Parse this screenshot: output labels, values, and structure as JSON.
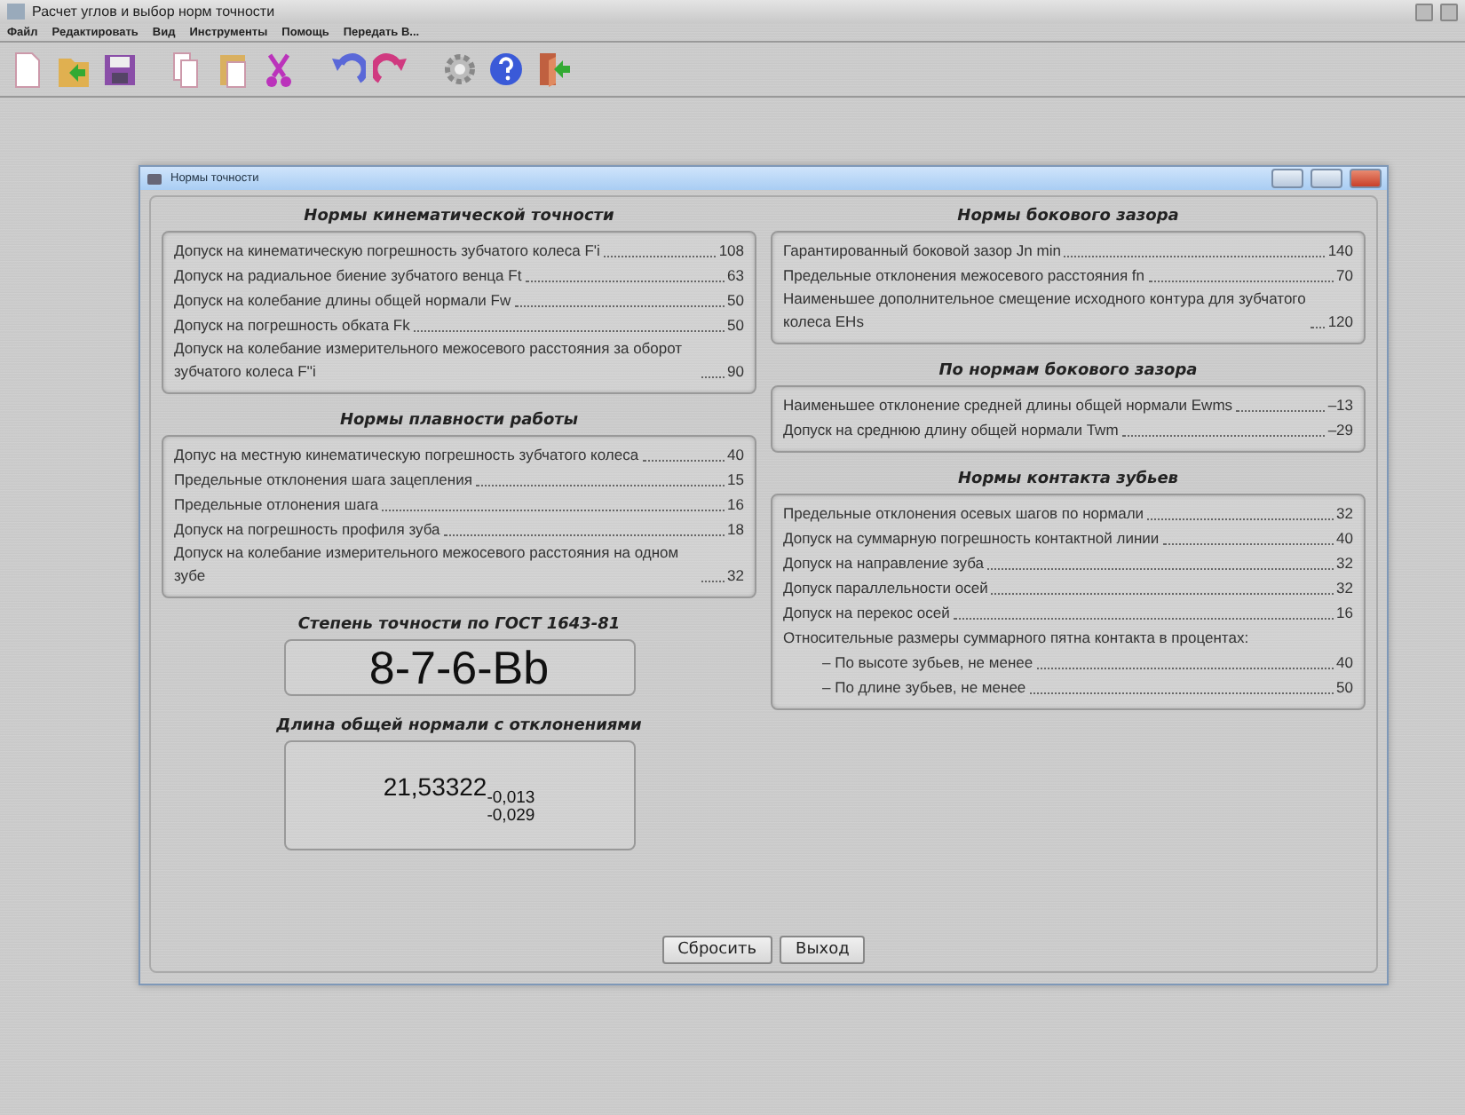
{
  "window": {
    "title": "Расчет углов и выбор норм точности"
  },
  "menu": [
    "Файл",
    "Редактировать",
    "Вид",
    "Инструменты",
    "Помощь",
    "Передать В..."
  ],
  "dialog": {
    "title": "Нормы точности",
    "left_column": [
      {
        "title": "Нормы кинематической точности",
        "rows": [
          {
            "kind": "item",
            "label": "Допуск на кинематическую погрешность зубчатого колеса F'i",
            "value": "108"
          },
          {
            "kind": "item",
            "label": "Допуск на радиальное биение зубчатого венца Ft",
            "value": "63"
          },
          {
            "kind": "item",
            "label": "Допуск на колебание длины общей нормали Fw",
            "value": "50"
          },
          {
            "kind": "item",
            "label": "Допуск на погрешность обката Fk",
            "value": "50"
          },
          {
            "kind": "item",
            "label": "Допуск на колебание измерительного межосевого расстояния за оборот зубчатого колеса F''i",
            "value": "90"
          }
        ]
      },
      {
        "title": "Нормы плавности работы",
        "rows": [
          {
            "kind": "item",
            "label": "Допус на местную кинематическую погрешность зубчатого колеса",
            "value": "40"
          },
          {
            "kind": "item",
            "label": "Предельные отклонения шага зацепления",
            "value": "15"
          },
          {
            "kind": "item",
            "label": "Предельные отлонения шага",
            "value": "16"
          },
          {
            "kind": "item",
            "label": "Допуск на погрешность профиля зуба",
            "value": "18"
          },
          {
            "kind": "item",
            "label": "Допуск на колебание измерительного межосевого расстояния на одном зубе",
            "value": "32"
          }
        ]
      }
    ],
    "right_column": [
      {
        "title": "Нормы бокового зазора",
        "rows": [
          {
            "kind": "item",
            "label": "Гарантированный боковой зазор Jn min",
            "value": "140"
          },
          {
            "kind": "item",
            "label": "Предельные отклонения межосевого расстояния fn",
            "value": "70"
          },
          {
            "kind": "item",
            "label": "Наименьшее дополнительное смещение исходного контура для зубчатого колеса EHs",
            "value": "120"
          }
        ]
      },
      {
        "title": "По нормам бокового зазора",
        "rows": [
          {
            "kind": "item",
            "label": "Наименьшее отклонение средней длины общей нормали Ewms",
            "value": "–13"
          },
          {
            "kind": "item",
            "label": "Допуск на среднюю длину общей нормали Twm",
            "value": "–29"
          }
        ]
      },
      {
        "title": "Нормы контакта зубьев",
        "rows": [
          {
            "kind": "item",
            "label": "Предельные отклонения осевых шагов по нормали",
            "value": "32"
          },
          {
            "kind": "item",
            "label": "Допуск на суммарную погрешность контактной линии",
            "value": "40"
          },
          {
            "kind": "item",
            "label": "Допуск на направление зуба",
            "value": "32"
          },
          {
            "kind": "item",
            "label": "Допуск параллельности осей",
            "value": "32"
          },
          {
            "kind": "item",
            "label": "Допуск на перекос осей",
            "value": "16"
          },
          {
            "kind": "note",
            "label": "Относительные размеры суммарного пятна контакта в процентах:"
          },
          {
            "kind": "sub",
            "label": "– По высоте зубьев, не менее",
            "value": "40"
          },
          {
            "kind": "sub",
            "label": "– По длине зубьев, не менее",
            "value": "50"
          }
        ]
      }
    ],
    "grade": {
      "title": "Степень точности по ГОСТ 1643-81",
      "value": "8-7-6-Bb"
    },
    "length": {
      "title": "Длина общей нормали с отклонениями",
      "value": "21,53322",
      "upper": "-0,013",
      "lower": "-0,029"
    },
    "buttons": [
      "Сбросить",
      "Выход"
    ]
  }
}
